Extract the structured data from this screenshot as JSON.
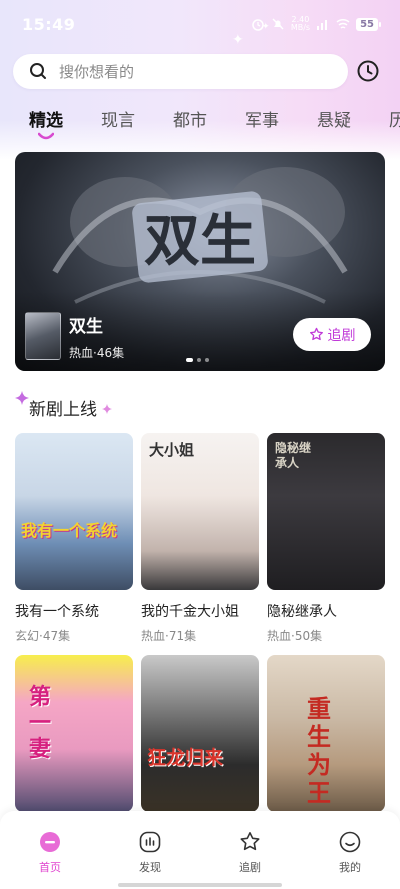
{
  "status_bar": {
    "time": "15:49",
    "net_speed_value": "2.40",
    "net_speed_unit": "MB/s",
    "battery": "55"
  },
  "search": {
    "placeholder": "搜你想看的"
  },
  "tabs": [
    {
      "label": "精选",
      "active": true
    },
    {
      "label": "现言",
      "active": false
    },
    {
      "label": "都市",
      "active": false
    },
    {
      "label": "军事",
      "active": false
    },
    {
      "label": "悬疑",
      "active": false
    },
    {
      "label": "历",
      "active": false
    }
  ],
  "banner": {
    "title": "双生",
    "subtitle": "热血·46集",
    "follow_label": "追剧",
    "poster_text": "双生",
    "page_index": 1,
    "page_count": 3
  },
  "section": {
    "title": "新剧上线"
  },
  "dramas": [
    {
      "title": "我有一个系统",
      "meta": "玄幻·47集",
      "poster_text": "我有一个系统"
    },
    {
      "title": "我的千金大小姐",
      "meta": "热血·71集",
      "poster_text": "大小姐"
    },
    {
      "title": "隐秘继承人",
      "meta": "热血·50集",
      "poster_text": "隐秘继承人"
    },
    {
      "title": "",
      "meta": "",
      "poster_text": "第一妻"
    },
    {
      "title": "",
      "meta": "",
      "poster_text": "狂龙归来"
    },
    {
      "title": "",
      "meta": "",
      "poster_text": "重生为王"
    }
  ],
  "bottom_nav": [
    {
      "label": "首页",
      "icon": "home-icon",
      "active": true
    },
    {
      "label": "发现",
      "icon": "discover-icon",
      "active": false
    },
    {
      "label": "追剧",
      "icon": "star-icon",
      "active": false
    },
    {
      "label": "我的",
      "icon": "profile-icon",
      "active": false
    }
  ],
  "colors": {
    "accent": "#e044cf",
    "follow_text": "#c03ad8"
  }
}
